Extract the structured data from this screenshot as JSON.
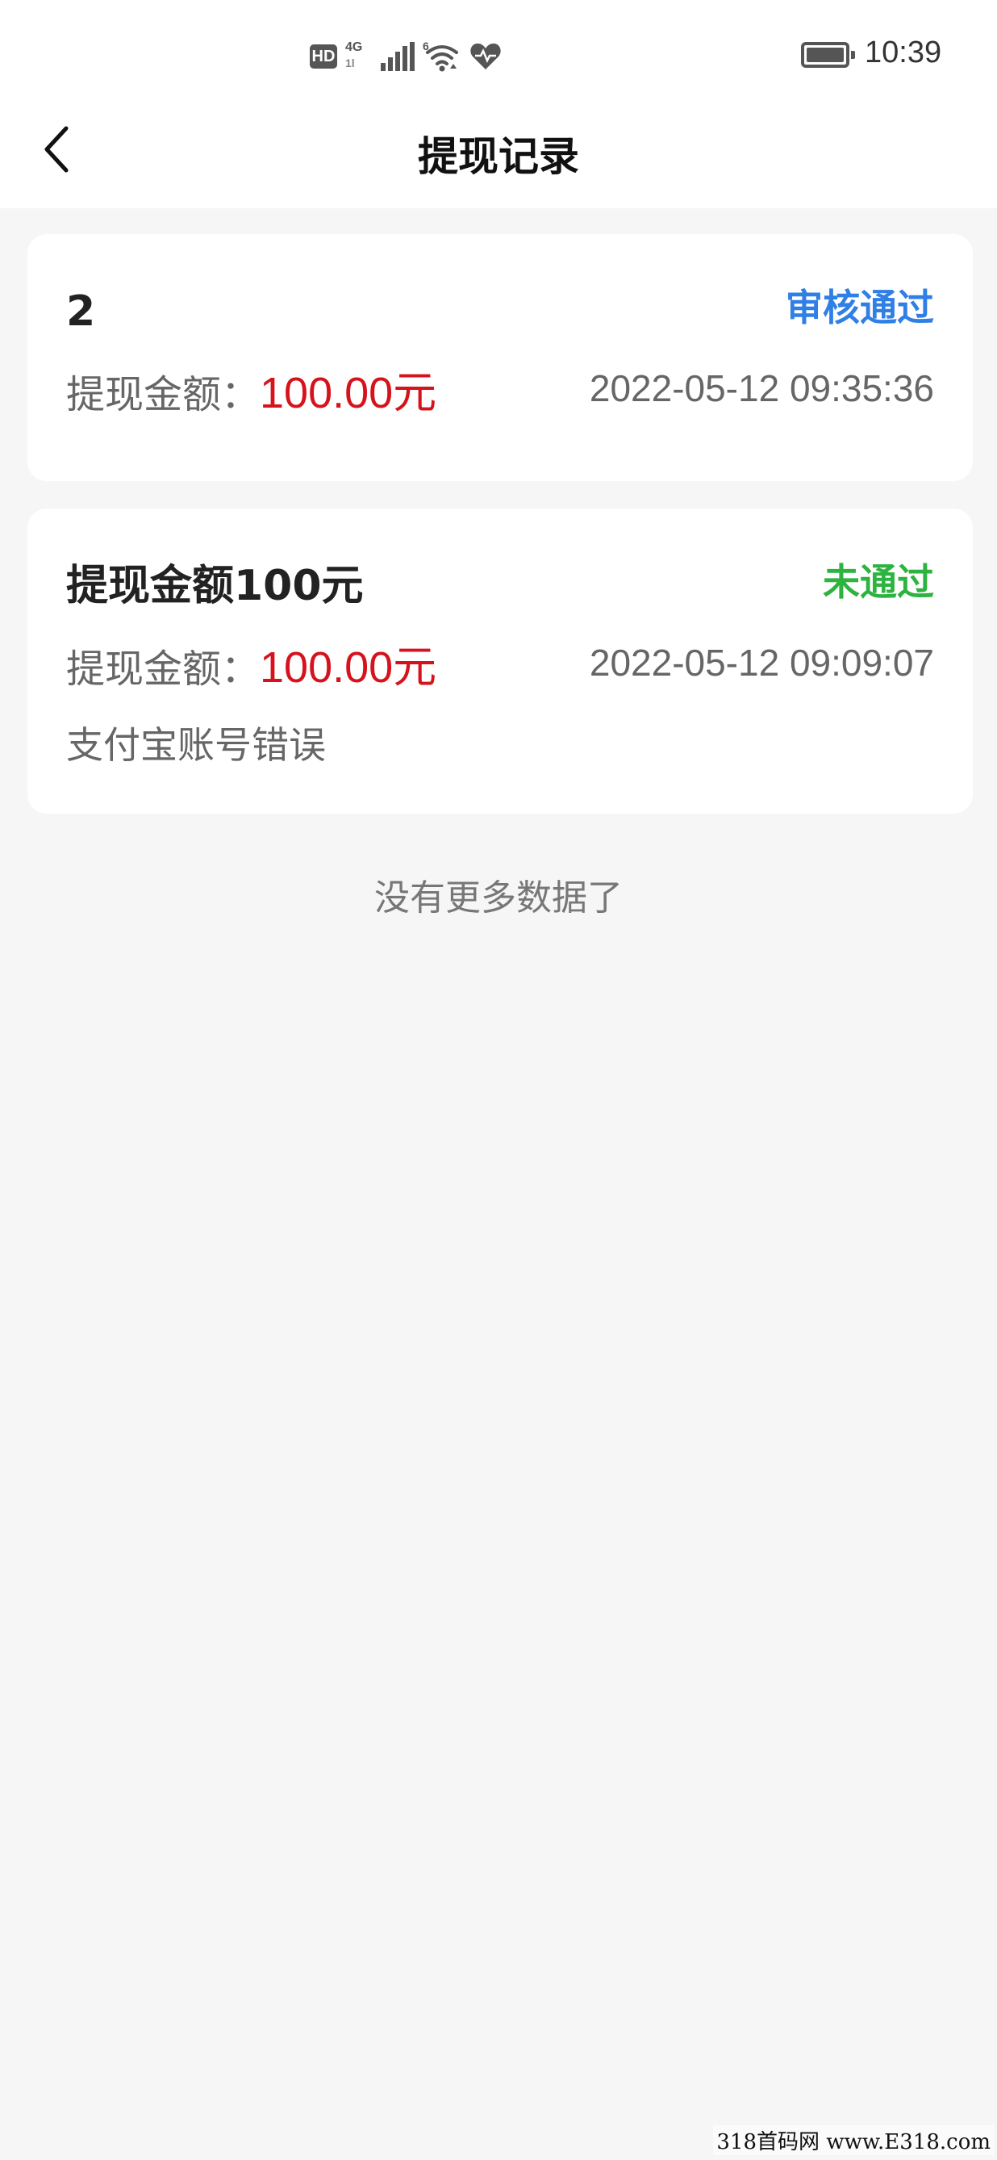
{
  "status_bar": {
    "hd": "HD",
    "network_type": "4G",
    "network_sub": "1l",
    "wifi_badge": "6",
    "time": "10:39",
    "battery_level": 0.9,
    "icons": [
      "hd-icon",
      "4g-icon",
      "signal-icon",
      "wifi-icon",
      "heart-health-icon",
      "battery-icon"
    ]
  },
  "header": {
    "title": "提现记录",
    "back_icon": "chevron-left-icon"
  },
  "records": [
    {
      "title": "2",
      "status": "审核通过",
      "status_color": "#2f7fe6",
      "amount_label": "提现金额：",
      "amount": "100.00元",
      "time": "2022-05-12 09:35:36"
    },
    {
      "title": "提现金额100元",
      "status": "未通过",
      "status_color": "#2db33f",
      "amount_label": "提现金额：",
      "amount": "100.00元",
      "time": "2022-05-12 09:09:07",
      "reason": "支付宝账号错误"
    }
  ],
  "footer": {
    "no_more": "没有更多数据了"
  },
  "watermark": "318首码网 www.E318.com",
  "colors": {
    "amount": "#d6121c",
    "background": "#f6f6f6",
    "card": "#ffffff"
  }
}
